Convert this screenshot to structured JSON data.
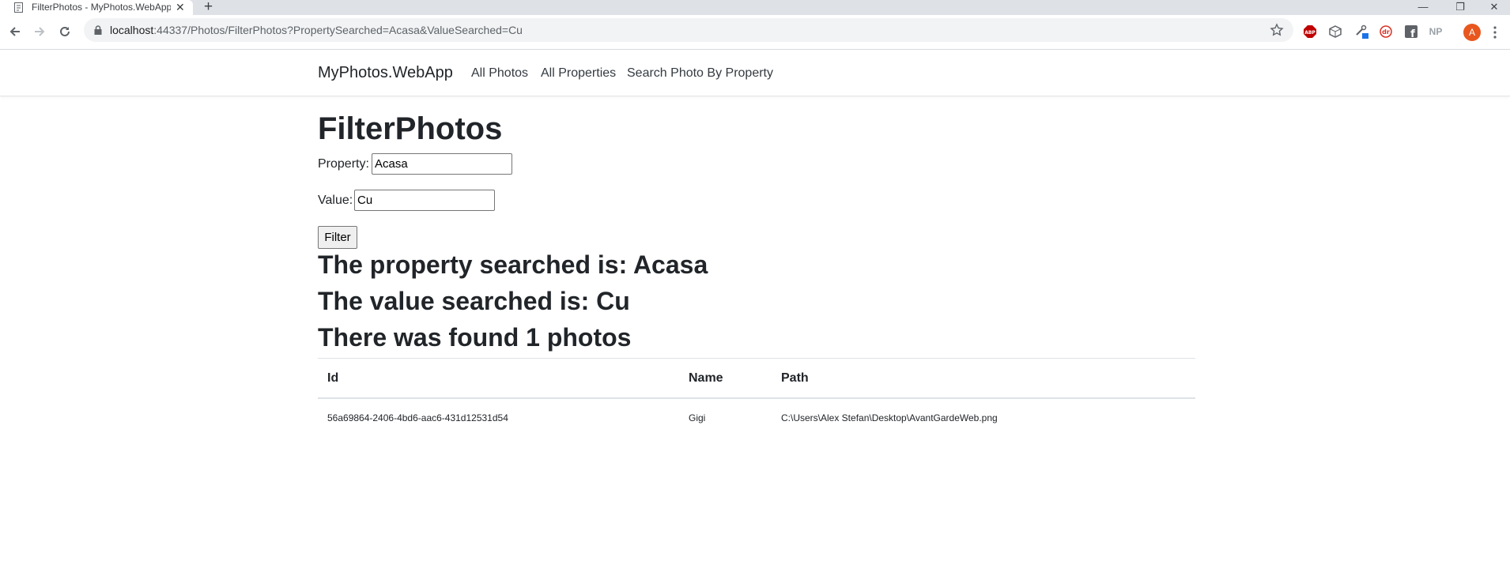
{
  "browser": {
    "tab_title": "FilterPhotos - MyPhotos.WebApp",
    "tab_close": "✕",
    "new_tab": "+",
    "url_host": "localhost",
    "url_rest": ":44337/Photos/FilterPhotos?PropertySearched=Acasa&ValueSearched=Cu",
    "profile_initial": "A",
    "window_controls": {
      "minimize": "—",
      "restore": "❐",
      "close": "✕"
    },
    "extensions": [
      "ABP",
      "box-icon",
      "tools-icon",
      "dr-icon",
      "f",
      "NP"
    ]
  },
  "navbar": {
    "brand": "MyPhotos.WebApp",
    "links": [
      "All Photos",
      "All Properties",
      "Search Photo By Property"
    ]
  },
  "page": {
    "title": "FilterPhotos",
    "property_label": "Property:",
    "property_value": "Acasa",
    "value_label": "Value:",
    "value_value": "Cu",
    "filter_button": "Filter",
    "property_result": "The property searched is: Acasa",
    "value_result": "The value searched is: Cu",
    "count_result": "There was found 1 photos"
  },
  "table": {
    "headers": [
      "Id",
      "Name",
      "Path"
    ],
    "rows": [
      [
        "56a69864-2406-4bd6-aac6-431d12531d54",
        "Gigi",
        "C:\\Users\\Alex Stefan\\Desktop\\AvantGardeWeb.png"
      ]
    ]
  },
  "colors": {
    "tabstrip": "#dee1e6",
    "omnibox": "#f1f3f4",
    "profile": "#e8571e",
    "abp": "#c00000"
  }
}
